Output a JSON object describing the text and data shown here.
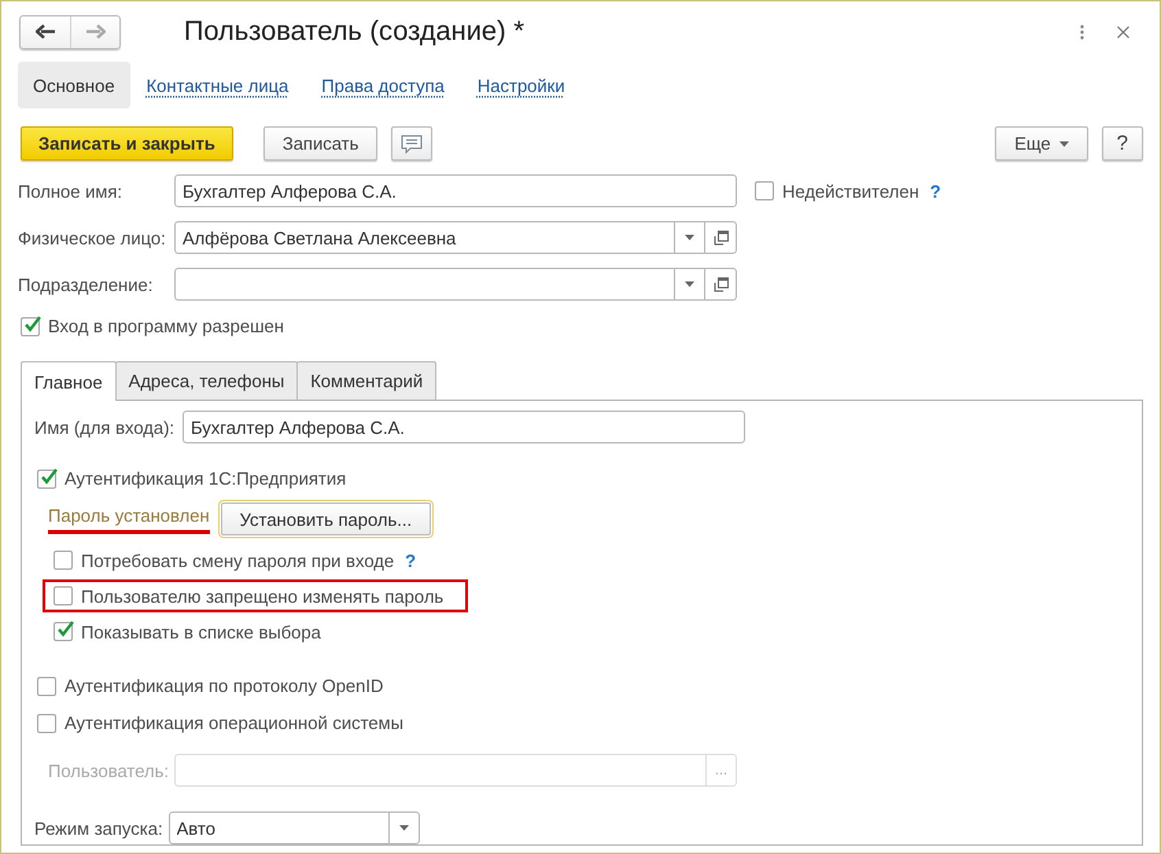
{
  "window": {
    "title": "Пользователь (создание) *"
  },
  "sections": [
    {
      "label": "Основное",
      "selected": true
    },
    {
      "label": "Контактные лица",
      "selected": false
    },
    {
      "label": "Права доступа",
      "selected": false
    },
    {
      "label": "Настройки",
      "selected": false
    }
  ],
  "toolbar": {
    "buttons": [
      {
        "label": "Записать и закрыть",
        "kind": "primary"
      },
      {
        "label": "Записать",
        "kind": "normal"
      },
      {
        "kind": "comment"
      }
    ],
    "more": "Еще",
    "help": "?"
  },
  "fields": [
    {
      "label": "Полное имя:",
      "value": "Бухгалтер Алферова С.А.",
      "kind": "text",
      "checkbox": {
        "label": "Недействителен",
        "checked": false,
        "help": "?"
      }
    },
    {
      "label": "Физическое лицо:",
      "value": "Алфёрова Светлана Алексеевна",
      "kind": "reference"
    },
    {
      "label": "Подразделение:",
      "kind": "reference"
    }
  ],
  "login_allowed": {
    "label": "Вход в программу разрешен",
    "checked": true
  },
  "tabs": [
    {
      "label": "Главное",
      "selected": true
    },
    {
      "label": "Адреса, телефоны",
      "selected": false
    },
    {
      "label": "Комментарий",
      "selected": false
    }
  ],
  "login_name": {
    "label": "Имя (для входа):",
    "value": "Бухгалтер Алферова С.А."
  },
  "auth_options": [
    {
      "label": "Аутентификация 1С:Предприятия",
      "checked": true,
      "password": {
        "status": "Пароль установлен",
        "annotated": true,
        "button": "Установить пароль...",
        "focused": true
      },
      "children": [
        {
          "label": "Потребовать смену пароля при входе",
          "checked": false,
          "help": "?",
          "annotated": false
        },
        {
          "label": "Пользователю запрещено изменять пароль",
          "checked": false,
          "annotated": true
        },
        {
          "label": "Показывать в списке выбора",
          "checked": true,
          "annotated": false
        }
      ]
    },
    {
      "label": "Аутентификация по протоколу OpenID",
      "checked": false
    },
    {
      "label": "Аутентификация операционной системы",
      "checked": false
    }
  ],
  "os_user": {
    "label": "Пользователь:",
    "disabled": true,
    "button": "..."
  },
  "launch_mode": {
    "label": "Режим запуска:",
    "value": "Авто"
  }
}
